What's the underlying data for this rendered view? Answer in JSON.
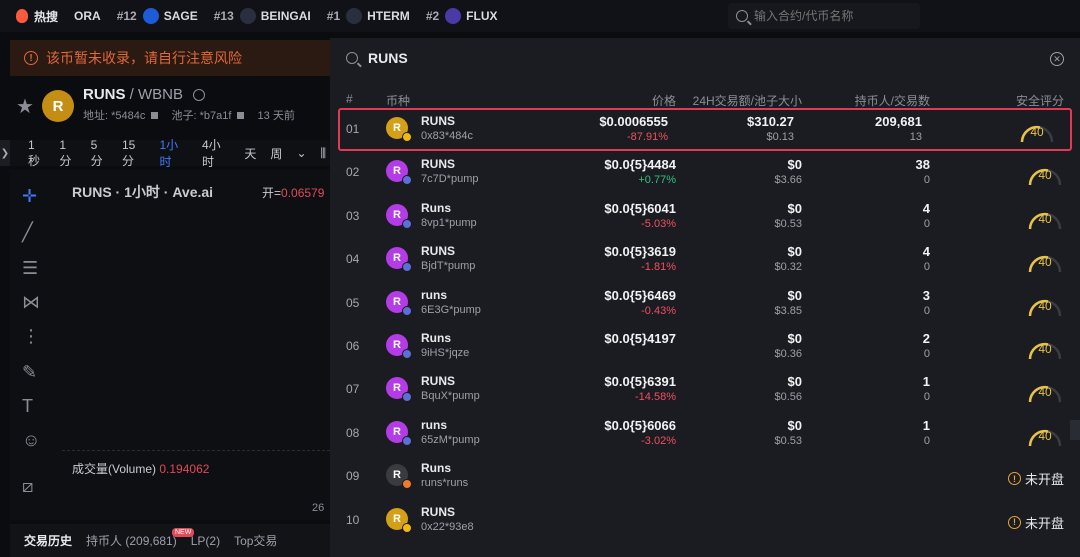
{
  "topbar": {
    "hot_label": "热搜",
    "tickers": [
      {
        "rank": "",
        "name": "ORA",
        "color": "#ffffff"
      },
      {
        "rank": "#12",
        "name": "SAGE",
        "color": "#1e5bd8"
      },
      {
        "rank": "#13",
        "name": "BEINGAI",
        "color": "#2a2f3f"
      },
      {
        "rank": "#1",
        "name": "HTERM",
        "color": "#2a2f3f"
      },
      {
        "rank": "#2",
        "name": "FLUX",
        "color": "#4a3aa8"
      }
    ],
    "search_placeholder": "输入合约/代币名称"
  },
  "warning": {
    "text": "该币暂未收录，请自行注意风险"
  },
  "token": {
    "avatar": "R",
    "name": "RUNS",
    "pair": " / WBNB",
    "address": "地址: *5484c",
    "pool": "池子: *b7a1f",
    "age": "13 天前"
  },
  "timeframes": [
    "1秒",
    "1分",
    "5分",
    "15分",
    "1小时",
    "4小时",
    "天",
    "周"
  ],
  "active_timeframe": "1小时",
  "chart": {
    "title": "RUNS · 1小时 · Ave.ai",
    "open_label": "开=",
    "open_value": "0.06579",
    "volume_label": "成交量(Volume)",
    "volume_value": "0.194062",
    "axis_tick": "26"
  },
  "bottom_tabs": [
    "交易历史",
    "持币人 (209,681)",
    "LP(2)",
    "Top交易"
  ],
  "bottom_new_badge": "NEW",
  "panel": {
    "query": "RUNS",
    "headers": {
      "idx": "#",
      "coin": "币种",
      "price": "价格",
      "volume": "24H交易额/池子大小",
      "holders": "持币人/交易数",
      "score": "安全评分"
    },
    "rows": [
      {
        "idx": "01",
        "name": "RUNS",
        "addr": "0x83*484c",
        "price": "$0.0006555",
        "change": "-87.91%",
        "vol": "$310.27",
        "pool": "$0.13",
        "holders": "209,681",
        "txs": "13",
        "score": "40",
        "avatar_color": "#d4a017",
        "chain_color": "#f0b90b",
        "dir": "neg",
        "selected": true
      },
      {
        "idx": "02",
        "name": "RUNS",
        "addr": "7c7D*pump",
        "price": "$0.0{5}4484",
        "change": "+0.77%",
        "vol": "$0",
        "pool": "$3.66",
        "holders": "38",
        "txs": "0",
        "score": "40",
        "avatar_color": "#b43ce6",
        "chain_color": "#5b6fd6",
        "dir": "pos"
      },
      {
        "idx": "03",
        "name": "Runs",
        "addr": "8vp1*pump",
        "price": "$0.0{5}6041",
        "change": "-5.03%",
        "vol": "$0",
        "pool": "$0.53",
        "holders": "4",
        "txs": "0",
        "score": "40",
        "avatar_color": "#b43ce6",
        "chain_color": "#5b6fd6",
        "dir": "neg"
      },
      {
        "idx": "04",
        "name": "RUNS",
        "addr": "BjdT*pump",
        "price": "$0.0{5}3619",
        "change": "-1.81%",
        "vol": "$0",
        "pool": "$0.32",
        "holders": "4",
        "txs": "0",
        "score": "40",
        "avatar_color": "#b43ce6",
        "chain_color": "#5b6fd6",
        "dir": "neg"
      },
      {
        "idx": "05",
        "name": "runs",
        "addr": "6E3G*pump",
        "price": "$0.0{5}6469",
        "change": "-0.43%",
        "vol": "$0",
        "pool": "$3.85",
        "holders": "3",
        "txs": "0",
        "score": "40",
        "avatar_color": "#b43ce6",
        "chain_color": "#5b6fd6",
        "dir": "neg"
      },
      {
        "idx": "06",
        "name": "Runs",
        "addr": "9iHS*jqze",
        "price": "$0.0{5}4197",
        "change": "",
        "vol": "$0",
        "pool": "$0.36",
        "holders": "2",
        "txs": "0",
        "score": "40",
        "avatar_color": "#b43ce6",
        "chain_color": "#5b6fd6",
        "dir": "neg"
      },
      {
        "idx": "07",
        "name": "RUNS",
        "addr": "BquX*pump",
        "price": "$0.0{5}6391",
        "change": "-14.58%",
        "vol": "$0",
        "pool": "$0.56",
        "holders": "1",
        "txs": "0",
        "score": "40",
        "avatar_color": "#b43ce6",
        "chain_color": "#5b6fd6",
        "dir": "neg"
      },
      {
        "idx": "08",
        "name": "runs",
        "addr": "65zM*pump",
        "price": "$0.0{5}6066",
        "change": "-3.02%",
        "vol": "$0",
        "pool": "$0.53",
        "holders": "1",
        "txs": "0",
        "score": "40",
        "avatar_color": "#b43ce6",
        "chain_color": "#5b6fd6",
        "dir": "neg"
      },
      {
        "idx": "09",
        "name": "Runs",
        "addr": "runs*runs",
        "price": "",
        "change": "",
        "vol": "",
        "pool": "",
        "holders": "",
        "txs": "",
        "score": "",
        "unopened": "未开盘",
        "avatar_color": "#3a3b40",
        "chain_color": "#f07a2a",
        "dir": "neg"
      },
      {
        "idx": "10",
        "name": "RUNS",
        "addr": "0x22*93e8",
        "price": "",
        "change": "",
        "vol": "",
        "pool": "",
        "holders": "",
        "txs": "",
        "score": "",
        "unopened": "未开盘",
        "avatar_color": "#d4a017",
        "chain_color": "#f0b90b",
        "dir": "neg"
      }
    ]
  }
}
